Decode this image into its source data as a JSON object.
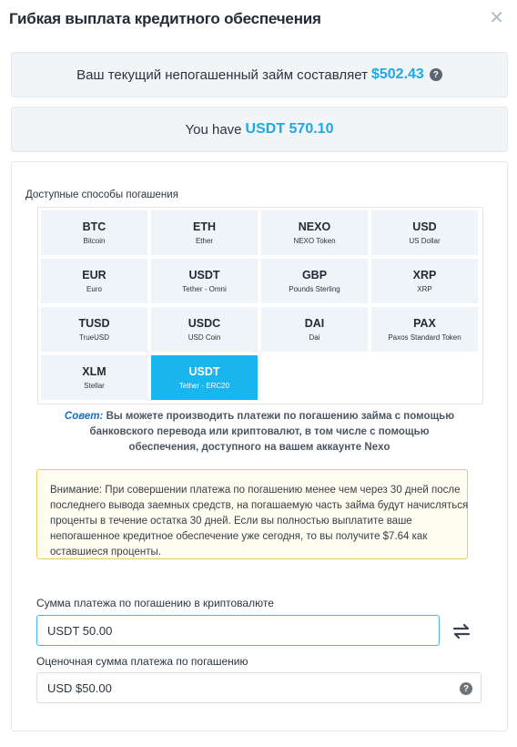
{
  "header": {
    "title": "Гибкая выплата кредитного обеспечения"
  },
  "loan_bar": {
    "text": "Ваш текущий непогашенный займ составляет",
    "amount": "$502.43"
  },
  "balance_bar": {
    "text": "You have",
    "amount": "USDT 570.10"
  },
  "methods": {
    "label": "Доступные способы погашения",
    "items": [
      {
        "code": "BTC",
        "name": "Bitcoin"
      },
      {
        "code": "ETH",
        "name": "Ether"
      },
      {
        "code": "NEXO",
        "name": "NEXO Token"
      },
      {
        "code": "USD",
        "name": "US Dollar"
      },
      {
        "code": "EUR",
        "name": "Euro"
      },
      {
        "code": "USDT",
        "name": "Tether - Omni"
      },
      {
        "code": "GBP",
        "name": "Pounds Sterling"
      },
      {
        "code": "XRP",
        "name": "XRP"
      },
      {
        "code": "TUSD",
        "name": "TrueUSD"
      },
      {
        "code": "USDC",
        "name": "USD Coin"
      },
      {
        "code": "DAI",
        "name": "Dai"
      },
      {
        "code": "PAX",
        "name": "Paxos Standard Token"
      },
      {
        "code": "XLM",
        "name": "Stellar"
      },
      {
        "code": "USDT",
        "name": "Tether - ERC20",
        "selected": true
      }
    ]
  },
  "tip": {
    "label": "Совет:",
    "text": "Вы можете производить платежи по погашению займа с помощью банковского перевода или криптовалют, в том числе с помощью обеспечения, доступного на вашем аккаунте Nexo"
  },
  "warning": {
    "text": "Внимание: При совершении платежа по погашению менее чем через 30 дней после последнего вывода заемных средств, на погашаемую часть займа будут начисляться проценты в течение остатка 30 дней. Если вы полностью выплатите ваше непогашенное кредитное обеспечение уже сегодня, то вы получите $7.64 как оставшиеся проценты."
  },
  "crypto_amount": {
    "label": "Сумма платежа по погашению в криптовалюте",
    "value": "USDT 50.00"
  },
  "estimated_amount": {
    "label": "Оценочная сумма платежа по погашению",
    "value": "USD $50.00"
  },
  "colors": {
    "accent": "#1fa8e6",
    "selected": "#18b5ee",
    "warning_border": "#f0cc5e"
  },
  "icons": {
    "close": "close-icon",
    "help": "question-circle-icon",
    "swap": "swap-arrows-icon"
  }
}
